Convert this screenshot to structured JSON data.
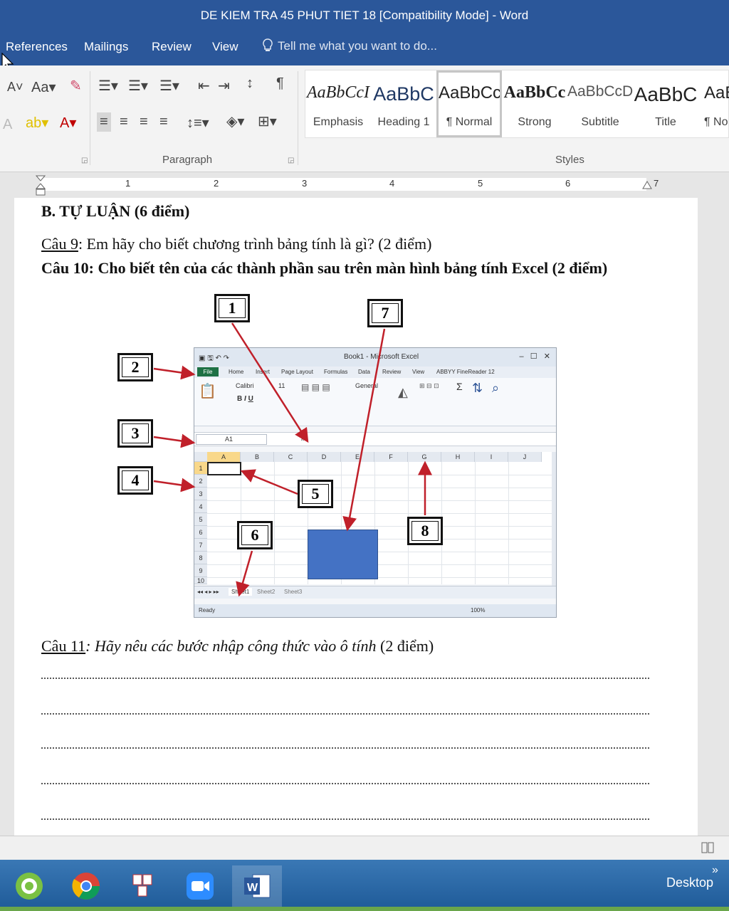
{
  "window": {
    "title": "DE KIEM TRA 45 PHUT TIET 18 [Compatibility Mode] - Word"
  },
  "ribbon_tabs": [
    "References",
    "Mailings",
    "Review",
    "View"
  ],
  "tell_me": {
    "placeholder": "Tell me what you want to do..."
  },
  "ribbon_groups": {
    "paragraph": "Paragraph",
    "styles": "Styles"
  },
  "font_tools": {
    "change_case": "Aa"
  },
  "styles": [
    {
      "sample": "AaBbCcI",
      "name": "Emphasis"
    },
    {
      "sample": "AaBbC",
      "name": "Heading 1"
    },
    {
      "sample": "AaBbCcI",
      "name": "¶ Normal",
      "selected": true
    },
    {
      "sample": "AaBbCc",
      "name": "Strong"
    },
    {
      "sample": "AaBbCcD",
      "name": "Subtitle"
    },
    {
      "sample": "AaBbC",
      "name": "Title"
    },
    {
      "sample": "AaB",
      "name": "¶ No"
    }
  ],
  "ruler": {
    "numbers": [
      "1",
      "2",
      "3",
      "4",
      "5",
      "6",
      "7"
    ]
  },
  "document": {
    "section_heading": "B. TỰ LUẬN (6 điểm)",
    "q9_label": "Câu 9",
    "q9_text": ":  Em hãy cho biết chương trình bảng tính là gì? (2 điểm)",
    "q10_text": "Câu 10: Cho biết tên của các thành phần sau trên màn hình bảng tính Excel (2 điểm)",
    "q11_label": "Câu 11",
    "q11_text": ": Hãy nêu các bước nhập công thức vào ô tính",
    "q11_points": " (2 điểm)"
  },
  "figure": {
    "callouts": [
      "1",
      "2",
      "3",
      "4",
      "5",
      "6",
      "7",
      "8"
    ],
    "excel": {
      "title": "Book1 - Microsoft Excel",
      "tabs": [
        "File",
        "Home",
        "Insert",
        "Page Layout",
        "Formulas",
        "Data",
        "Review",
        "View",
        "ABBYY FineReader 12"
      ],
      "name_box": "A1",
      "fx": "fx",
      "columns": [
        "A",
        "B",
        "C",
        "D",
        "E",
        "F",
        "G",
        "H",
        "I",
        "J"
      ],
      "rows": [
        "1",
        "2",
        "3",
        "4",
        "5",
        "6",
        "7",
        "8",
        "9",
        "10"
      ],
      "sheets": [
        "Sheet1",
        "Sheet2",
        "Sheet3"
      ],
      "status": "Ready",
      "zoom": "100%",
      "font": "Calibri",
      "font_size": "11",
      "number_format": "General"
    }
  },
  "taskbar": {
    "desktop_label": "Desktop"
  }
}
